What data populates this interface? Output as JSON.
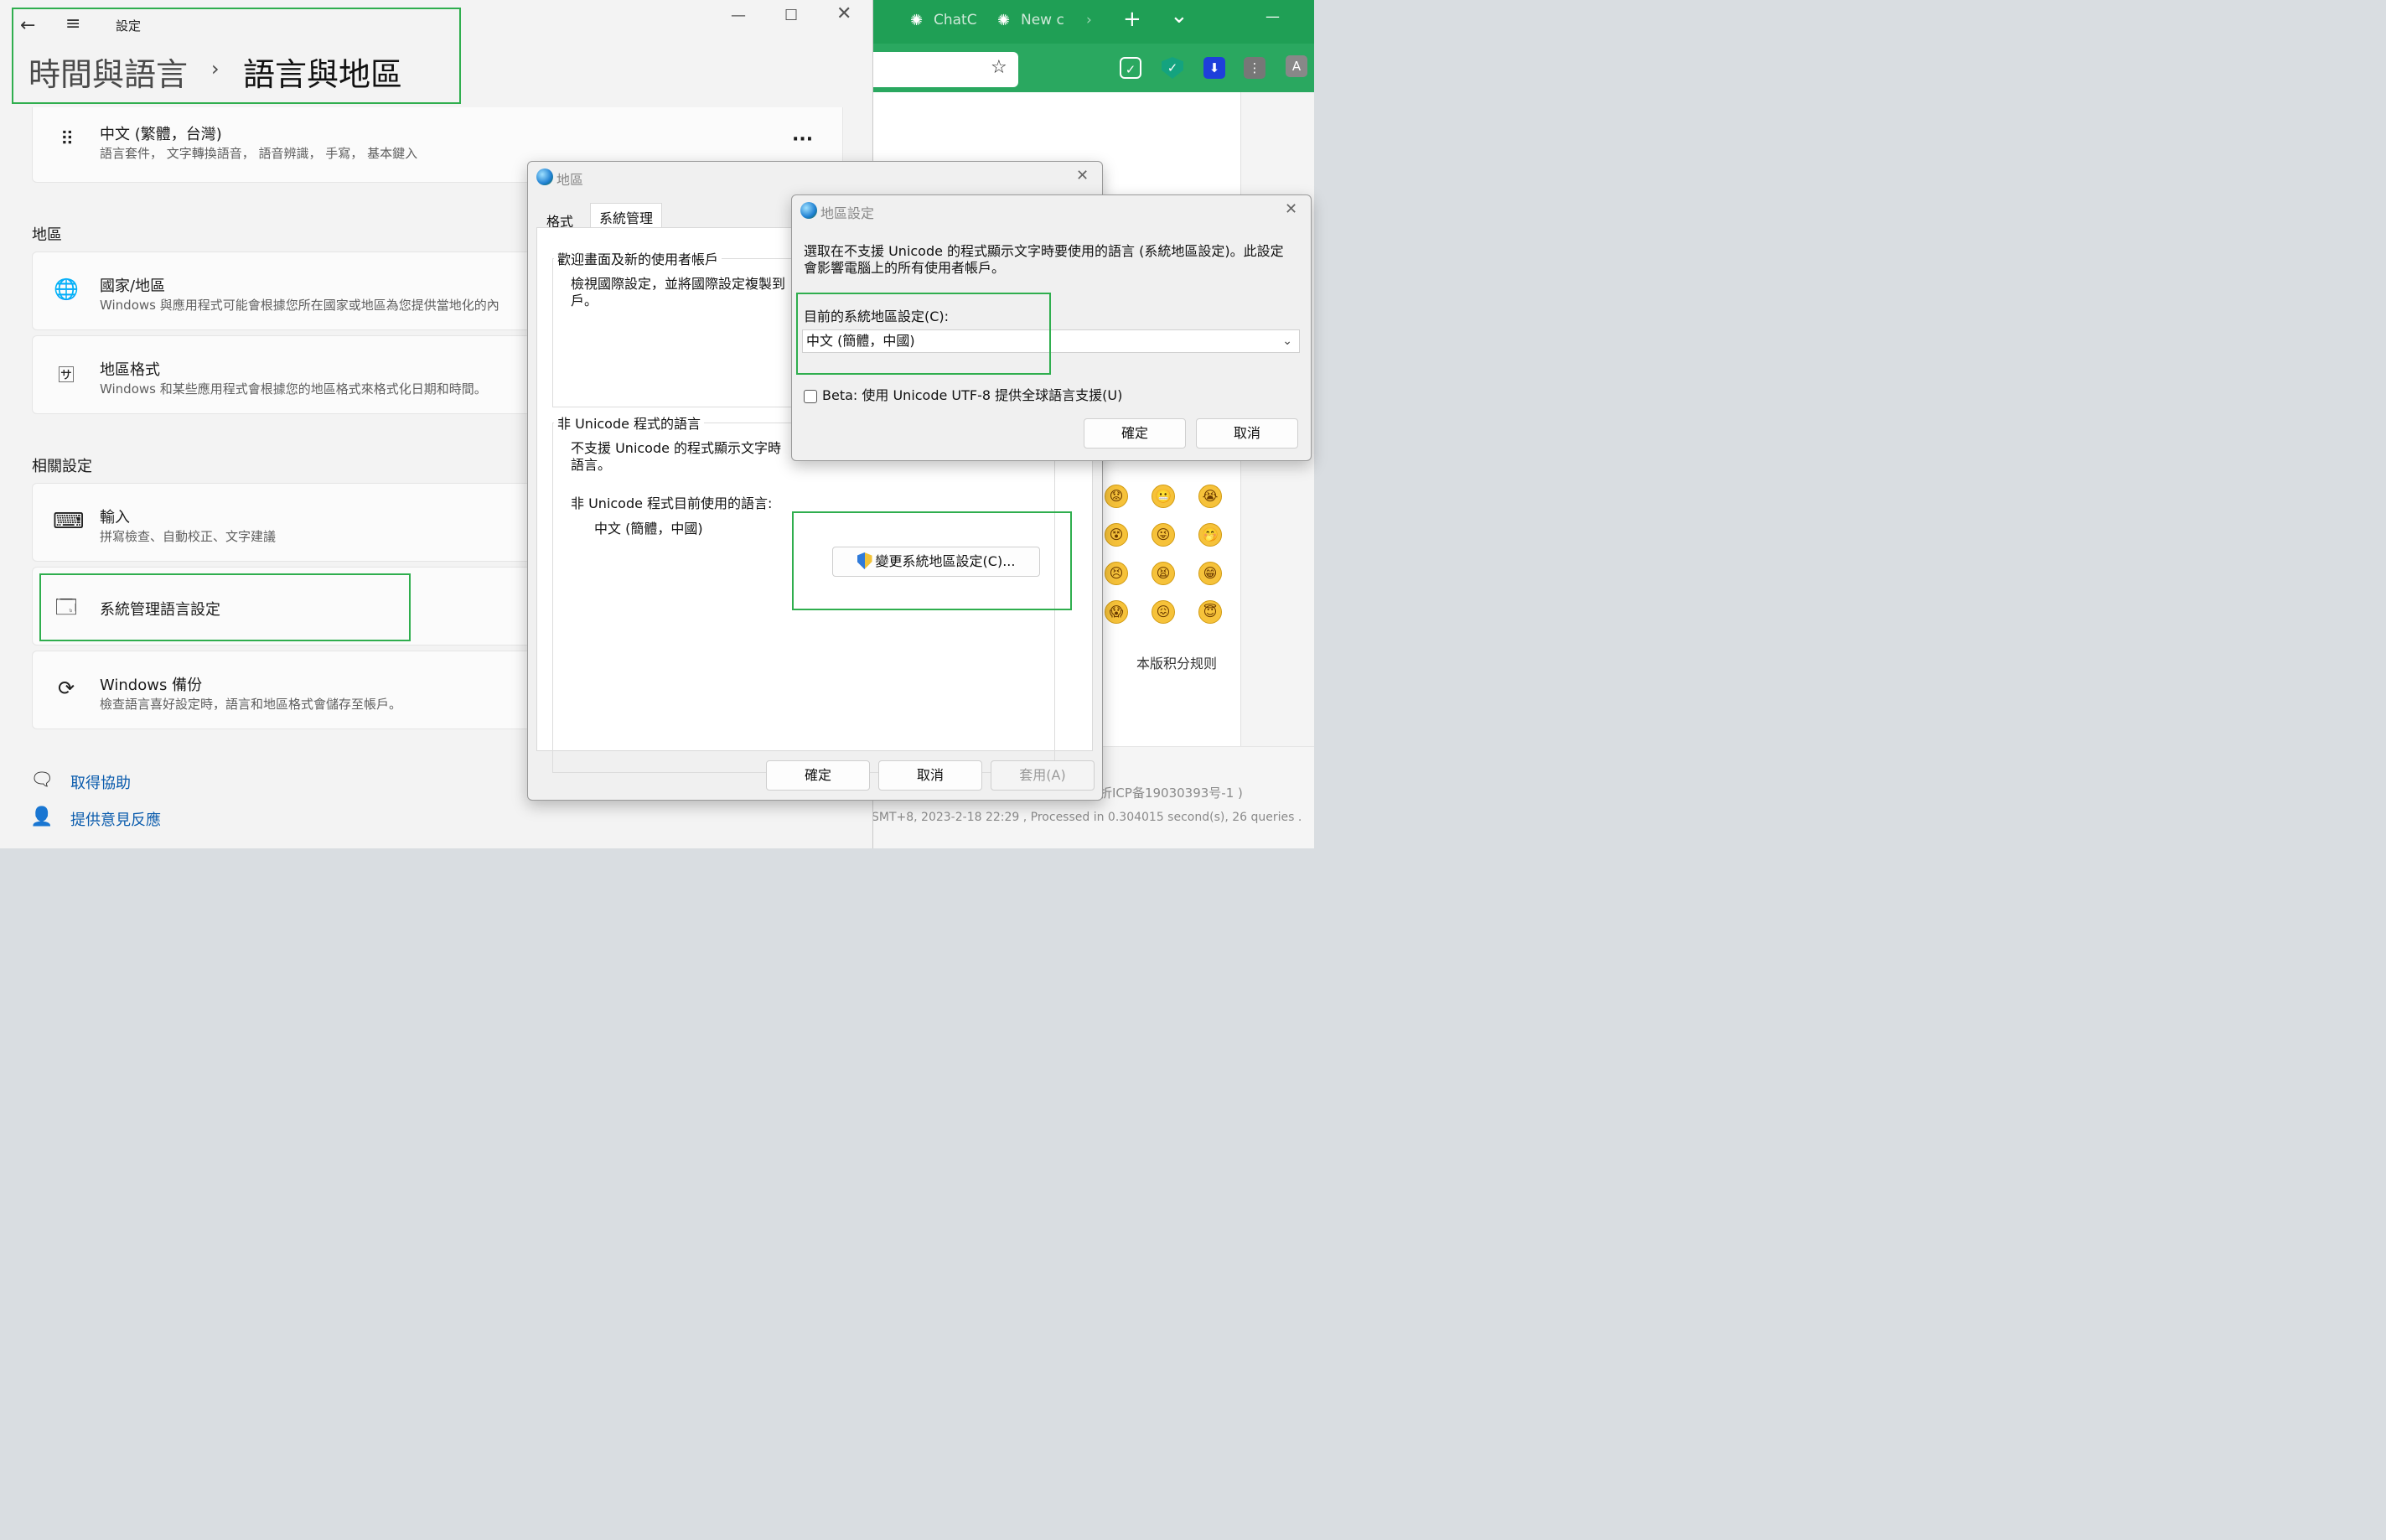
{
  "browser": {
    "tabs": [
      {
        "label": "ChatC"
      },
      {
        "label": "New c"
      }
    ],
    "tab_controls": {
      "new_tab": "+",
      "list": "⌄",
      "minimize": "—"
    },
    "emoji_grid": [
      "😟",
      "😬",
      "😭",
      "😵",
      "😜",
      "🤭",
      "😣",
      "😫",
      "😁",
      "😱",
      "😖",
      "😇"
    ],
    "rules_link": "本版积分规则",
    "icp": "折ICP备19030393号-1 )",
    "gmt": "SMT+8, 2023-2-18 22:29 , Processed in 0.304015 second(s), 26 queries .",
    "accent": "#1f9f55"
  },
  "settings": {
    "app_title": "設定",
    "breadcrumb": {
      "parent": "時間與語言",
      "separator": "›",
      "current": "語言與地區"
    },
    "language_card": {
      "title": "中文 (繁體，台灣)",
      "subtitle": "語言套件， 文字轉換語音， 語音辨識， 手寫， 基本鍵入",
      "more": "···"
    },
    "region_header": "地區",
    "country_card": {
      "title": "國家/地區",
      "subtitle": "Windows 與應用程式可能會根據您所在國家或地區為您提供當地化的內"
    },
    "format_card": {
      "title": "地區格式",
      "subtitle": "Windows 和某些應用程式會根據您的地區格式來格式化日期和時間。"
    },
    "related_header": "相關設定",
    "input_card": {
      "title": "輸入",
      "subtitle": "拼寫檢查、自動校正、文字建議"
    },
    "admin_card": {
      "title": "系統管理語言設定"
    },
    "backup_card": {
      "title": "Windows 備份",
      "subtitle": "檢查語言喜好設定時，語言和地區格式會儲存至帳戶。"
    },
    "help_link": "取得協助",
    "feedback_link": "提供意見反應",
    "highlight_color": "#2fae4e"
  },
  "region_dialog": {
    "title": "地區",
    "tabs": [
      "格式",
      "系統管理"
    ],
    "active_tab": "系統管理",
    "welcome_group": {
      "header": "歡迎畫面及新的使用者帳戶",
      "text_line1": "檢視國際設定，並將國際設定複製到",
      "text_line2": "戶。"
    },
    "unicode_group": {
      "header": "非 Unicode 程式的語言",
      "text_line1": "不支援 Unicode 的程式顯示文字時",
      "text_line2": "語言。",
      "current_label": "非 Unicode 程式目前使用的語言:",
      "current_value": "中文 (簡體，中國)",
      "change_button": "變更系統地區設定(C)..."
    },
    "ok": "確定",
    "cancel": "取消",
    "apply": "套用(A)"
  },
  "locale_dialog": {
    "title": "地區設定",
    "description_line1": "選取在不支援 Unicode 的程式顯示文字時要使用的語言 (系統地區設定)。此設定",
    "description_line2": "會影響電腦上的所有使用者帳戶。",
    "current_label": "目前的系統地區設定(C):",
    "current_value": "中文 (簡體，中國)",
    "beta_label": "Beta: 使用 Unicode UTF-8 提供全球語言支援(U)",
    "beta_checked": false,
    "ok": "確定",
    "cancel": "取消"
  }
}
